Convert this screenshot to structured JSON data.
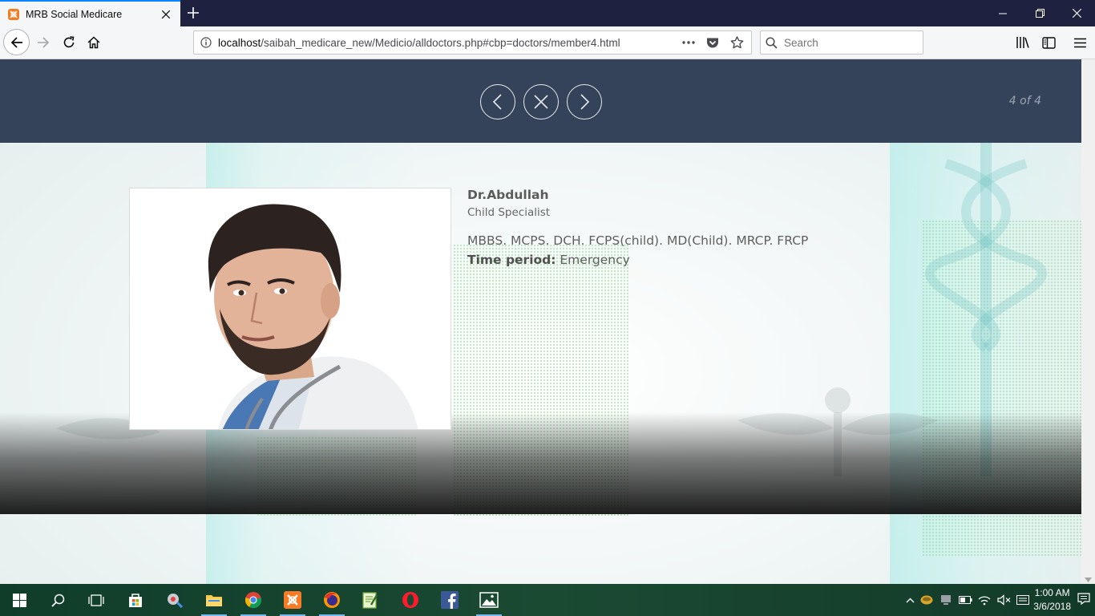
{
  "browser": {
    "tab_title": "MRB Social Medicare",
    "url_host": "localhost",
    "url_path": "/saibah_medicare_new/Medicio/alldoctors.php#cbp=doctors/member4.html",
    "search_placeholder": "Search"
  },
  "lightbox": {
    "counter": "4 of 4"
  },
  "doctor": {
    "name": "Dr.Abdullah",
    "specialty": "Child Specialist",
    "qualifications": "MBBS. MCPS. DCH. FCPS(child). MD(Child). MRCP. FRCP",
    "time_label": "Time period:",
    "time_value": "Emergency"
  },
  "taskbar": {
    "time": "1:00 AM",
    "date": "3/6/2018",
    "apps": [
      "start-icon",
      "search-icon",
      "task-view-icon",
      "store-icon",
      "media-icon",
      "file-explorer-icon",
      "chrome-icon",
      "xampp-icon",
      "firefox-icon",
      "notepad-plus-icon",
      "opera-icon",
      "facebook-icon",
      "photos-icon"
    ]
  },
  "colors": {
    "lightbox_bar": "#35435a",
    "tab_accent": "#0a84ff",
    "taskbar": "#1b4a33"
  }
}
